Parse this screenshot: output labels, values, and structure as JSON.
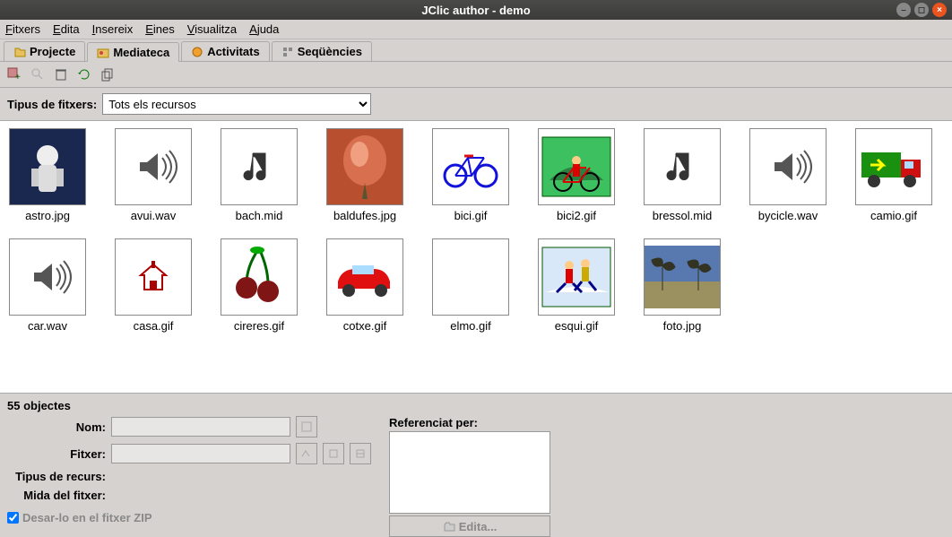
{
  "window": {
    "title": "JClic author - demo"
  },
  "menu": {
    "items": [
      "Fitxers",
      "Edita",
      "Insereix",
      "Eines",
      "Visualitza",
      "Ajuda"
    ]
  },
  "tabs": [
    {
      "icon": "project-icon",
      "label": "Projecte"
    },
    {
      "icon": "media-icon",
      "label": "Mediateca"
    },
    {
      "icon": "activities-icon",
      "label": "Activitats"
    },
    {
      "icon": "sequences-icon",
      "label": "Seqüències"
    }
  ],
  "active_tab": 1,
  "filter": {
    "label": "Tipus de fitxers:",
    "selected": "Tots els recursos"
  },
  "items": [
    {
      "name": "astro.jpg",
      "kind": "astro"
    },
    {
      "name": "avui.wav",
      "kind": "sound"
    },
    {
      "name": "bach.mid",
      "kind": "music"
    },
    {
      "name": "baldufes.jpg",
      "kind": "baldufes"
    },
    {
      "name": "bici.gif",
      "kind": "bike"
    },
    {
      "name": "bici2.gif",
      "kind": "bike2"
    },
    {
      "name": "bressol.mid",
      "kind": "music"
    },
    {
      "name": "bycicle.wav",
      "kind": "sound"
    },
    {
      "name": "camio.gif",
      "kind": "truck"
    },
    {
      "name": "car.wav",
      "kind": "sound"
    },
    {
      "name": "casa.gif",
      "kind": "house"
    },
    {
      "name": "cireres.gif",
      "kind": "cherry"
    },
    {
      "name": "cotxe.gif",
      "kind": "car"
    },
    {
      "name": "elmo.gif",
      "kind": "blank"
    },
    {
      "name": "esqui.gif",
      "kind": "ski"
    },
    {
      "name": "foto.jpg",
      "kind": "photo"
    }
  ],
  "panel": {
    "status": "55 objectes",
    "labels": {
      "nom": "Nom:",
      "fitxer": "Fitxer:",
      "tipus": "Tipus de recurs:",
      "mida": "Mida del fitxer:",
      "zip": "Desar-lo en el fitxer ZIP",
      "ref": "Referenciat per:",
      "edit": "Edita..."
    }
  }
}
